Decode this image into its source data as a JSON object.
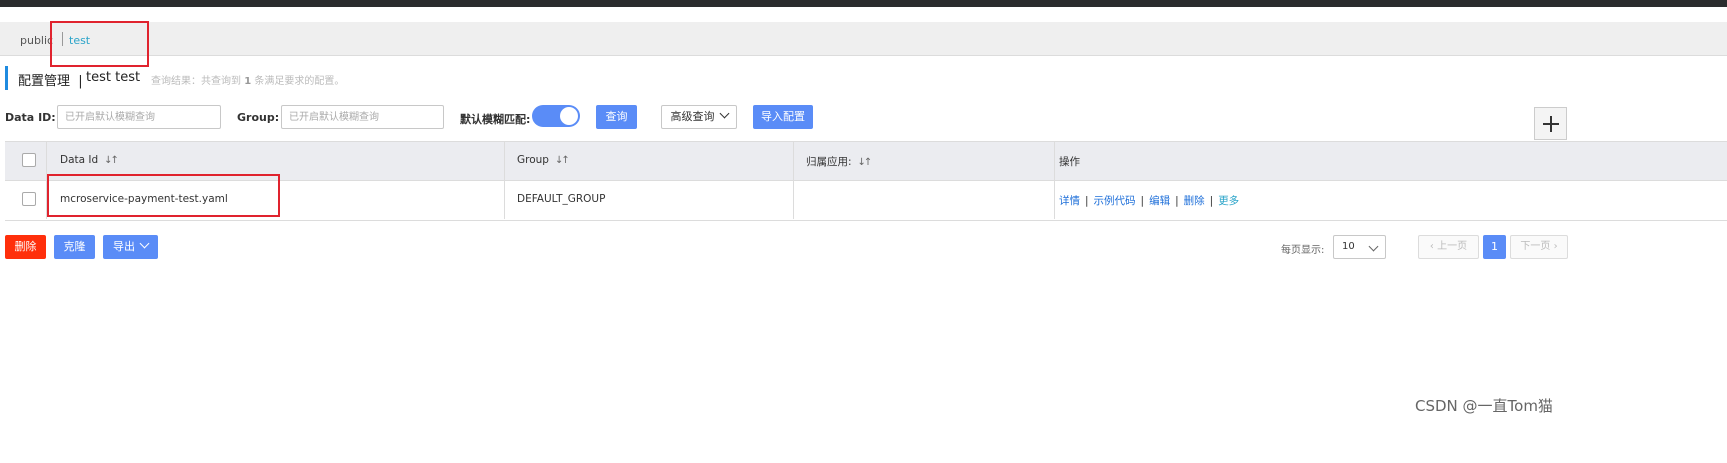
{
  "namespace_tabs": {
    "public": "public",
    "test": "test"
  },
  "title": {
    "main": "配置管理",
    "separator": "|",
    "namespace": "test  test",
    "summary_prefix": "查询结果：共查询到",
    "summary_count": "1",
    "summary_suffix": "条满足要求的配置。"
  },
  "filters": {
    "data_id_label": "Data ID:",
    "data_id_placeholder": "已开启默认模糊查询",
    "group_label": "Group:",
    "group_placeholder": "已开启默认模糊查询",
    "fuzzy_label": "默认模糊匹配:",
    "search_button": "查询",
    "advanced_button": "高级查询",
    "import_button": "导入配置"
  },
  "table": {
    "headers": {
      "data_id": "Data Id",
      "group": "Group",
      "app": "归属应用:",
      "ops": "操作"
    },
    "rows": [
      {
        "data_id": "mcroservice-payment-test.yaml",
        "group": "DEFAULT_GROUP",
        "app": "",
        "ops": {
          "detail": "详情",
          "sample": "示例代码",
          "edit": "编辑",
          "delete": "删除",
          "more": "更多"
        }
      }
    ]
  },
  "bulk_actions": {
    "delete": "删除",
    "clone": "克隆",
    "export": "导出"
  },
  "pagination": {
    "per_page_label": "每页显示:",
    "per_page_value": "10",
    "prev": "上一页",
    "current": "1",
    "next": "下一页"
  },
  "watermark": "CSDN @一直Tom猫",
  "colors": {
    "accent": "#5a8cf7",
    "danger": "#ff2f0b",
    "link": "#1e6fd9",
    "highlight_box": "#e0232e"
  }
}
